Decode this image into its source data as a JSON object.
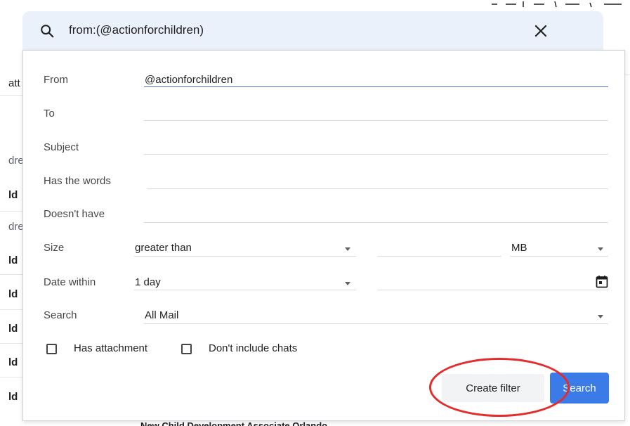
{
  "search": {
    "query": "from:(@actionforchildren)"
  },
  "background": {
    "fragments": [
      "att",
      "dre",
      "ld",
      "dre",
      "ld",
      "ld",
      "ld",
      "ld",
      "ld"
    ],
    "bottom_snippet": "New Child Development Associate Orlando"
  },
  "filter": {
    "labels": {
      "from": "From",
      "to": "To",
      "subject": "Subject",
      "has_words": "Has the words",
      "doesnt_have": "Doesn't have",
      "size": "Size",
      "date_within": "Date within",
      "search": "Search"
    },
    "values": {
      "from": "@actionforchildren",
      "size_operator": "greater than",
      "size_unit": "MB",
      "date_within": "1 day",
      "search_scope": "All Mail"
    },
    "checkboxes": {
      "has_attachment": "Has attachment",
      "dont_include_chats": "Don't include chats"
    },
    "buttons": {
      "create_filter": "Create filter",
      "search": "Search"
    }
  },
  "colors": {
    "search_bar_bg": "#eaf1fb",
    "primary_button": "#3b7be8",
    "highlight": "#e52b2b"
  }
}
